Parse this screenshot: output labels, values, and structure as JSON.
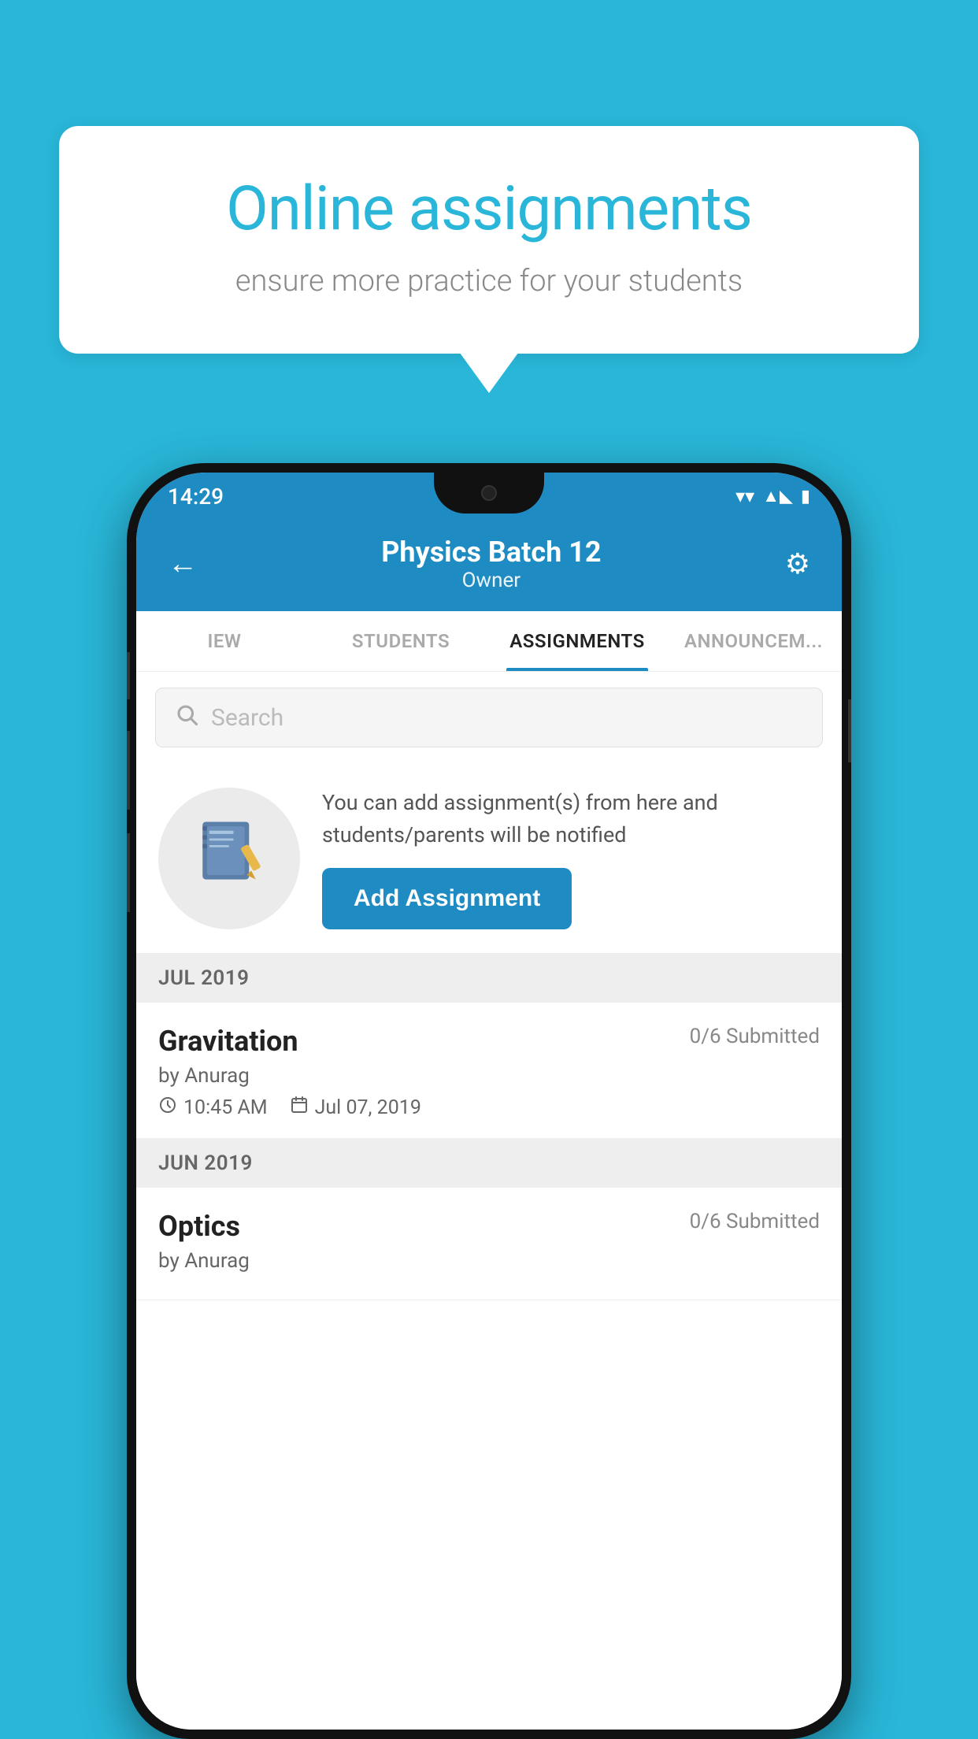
{
  "background_color": "#29B6D8",
  "speech_bubble": {
    "title": "Online assignments",
    "subtitle": "ensure more practice for your students"
  },
  "status_bar": {
    "time": "14:29",
    "wifi_icon": "▼",
    "signal_icon": "◣",
    "battery_icon": "▮"
  },
  "header": {
    "title": "Physics Batch 12",
    "subtitle": "Owner",
    "back_label": "←",
    "settings_label": "⚙"
  },
  "tabs": [
    {
      "label": "IEW",
      "active": false
    },
    {
      "label": "STUDENTS",
      "active": false
    },
    {
      "label": "ASSIGNMENTS",
      "active": true
    },
    {
      "label": "ANNOUNCEM...",
      "active": false
    }
  ],
  "search": {
    "placeholder": "Search"
  },
  "promo": {
    "description": "You can add assignment(s) from here and students/parents will be notified",
    "add_button_label": "Add Assignment"
  },
  "sections": [
    {
      "month_label": "JUL 2019",
      "assignments": [
        {
          "name": "Gravitation",
          "submitted": "0/6 Submitted",
          "by": "by Anurag",
          "time": "10:45 AM",
          "date": "Jul 07, 2019"
        }
      ]
    },
    {
      "month_label": "JUN 2019",
      "assignments": [
        {
          "name": "Optics",
          "submitted": "0/6 Submitted",
          "by": "by Anurag",
          "time": "",
          "date": ""
        }
      ]
    }
  ]
}
